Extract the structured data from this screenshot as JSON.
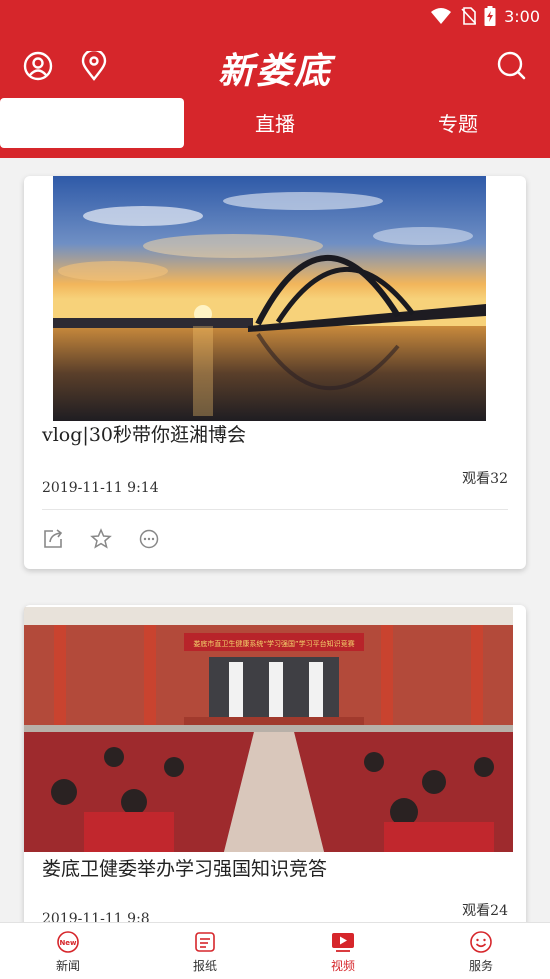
{
  "status": {
    "time": "3:00"
  },
  "header": {
    "logo": "新娄底"
  },
  "tabs": [
    {
      "label": ""
    },
    {
      "label": "直播"
    },
    {
      "label": "专题"
    }
  ],
  "articles": [
    {
      "title": "vlog|30秒带你逛湘博会",
      "views": "观看32",
      "date": "2019-11-11 9:14"
    },
    {
      "title": "娄底卫健委举办学习强国知识竞答",
      "views": "观看24",
      "date": "2019-11-11 9:8",
      "banner": "娄底市直卫生健康系统“学习强国”学习平台知识竞赛"
    }
  ],
  "bottom_nav": [
    {
      "label": "新闻",
      "icon": "news-icon"
    },
    {
      "label": "报纸",
      "icon": "newspaper-icon"
    },
    {
      "label": "视频",
      "icon": "video-icon"
    },
    {
      "label": "服务",
      "icon": "service-icon"
    }
  ],
  "colors": {
    "brand": "#d6262b"
  }
}
